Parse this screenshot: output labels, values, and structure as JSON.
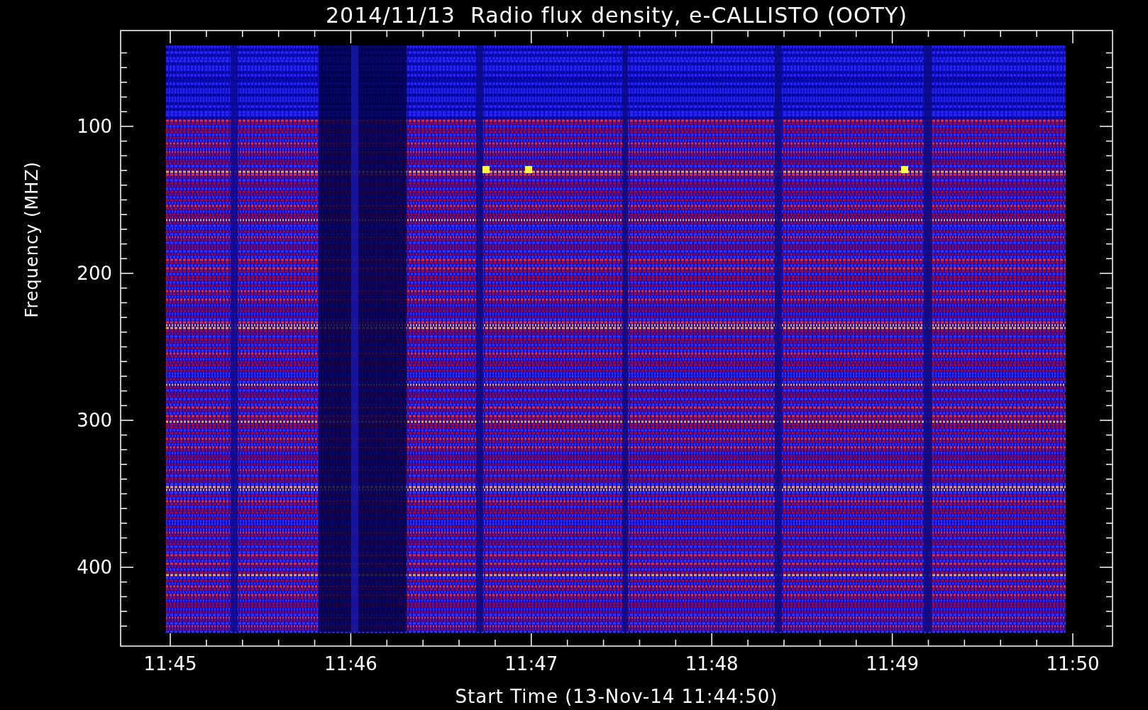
{
  "title": "2014/11/13  Radio flux density, e-CALLISTO (OOTY)",
  "y_axis": {
    "label": "Frequency (MHZ)",
    "ticks": [
      "100",
      "200",
      "300",
      "400"
    ]
  },
  "x_axis": {
    "label": "Start Time (13-Nov-14 11:44:50)",
    "ticks": [
      "11:45",
      "11:46",
      "11:47",
      "11:48",
      "11:49",
      "11:50"
    ]
  }
}
